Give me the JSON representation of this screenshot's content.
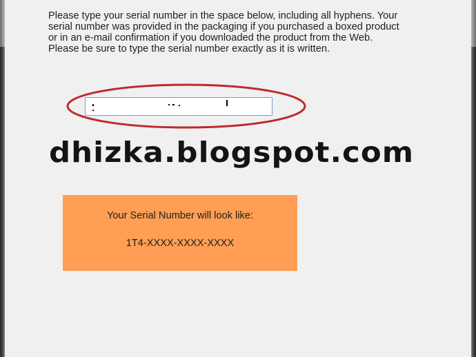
{
  "instructions": {
    "line1": "Please type your serial number in the space below, including all hyphens. Your",
    "line2": "serial number was provided in the packaging if you purchased a boxed product",
    "line3": "or in an e-mail confirmation if you downloaded the product from the Web.",
    "line4": "Please be sure to type the serial number exactly as it is written."
  },
  "serial_field": {
    "value": ""
  },
  "watermark": {
    "text": "dhizka.blogspot.com"
  },
  "example": {
    "title": "Your Serial Number will look like:",
    "value": "1T4-XXXX-XXXX-XXXX",
    "background_color": "#ff9e54"
  },
  "annotation": {
    "ellipse_color": "#c0282d"
  }
}
